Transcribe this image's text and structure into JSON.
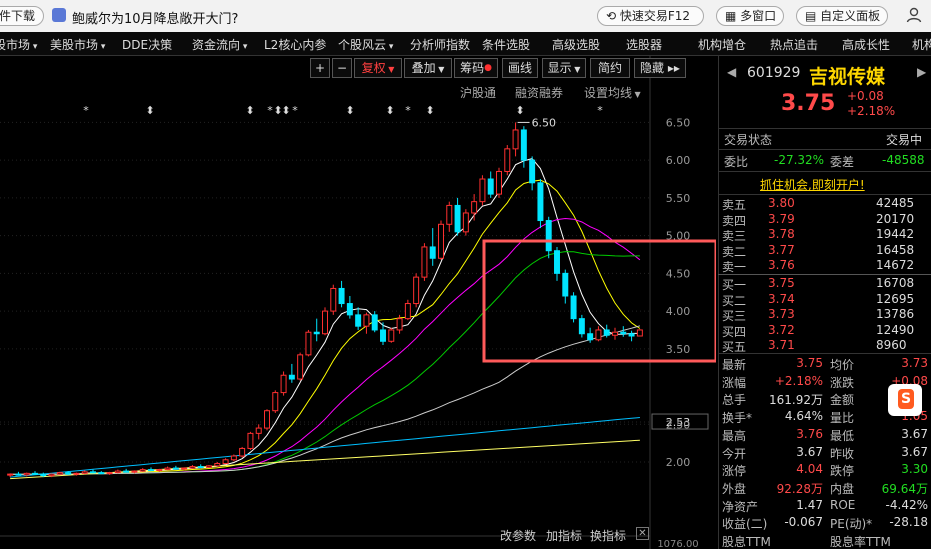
{
  "topbar": {
    "left_button": "软件下载",
    "news": "鲍威尔为10月降息敞开大门?",
    "quick_trade": "快速交易F12",
    "multi_window": "多窗口",
    "custom_panel": "自定义面板"
  },
  "menu": [
    "股市场",
    "美股市场",
    "DDE决策",
    "资金流向",
    "L2核心内参",
    "个股风云",
    "分析师指数",
    "条件选股",
    "高级选股",
    "选股器",
    "机构增仓",
    "热点追击",
    "高成长性",
    "机构"
  ],
  "chart_toolbar": {
    "plus": "+",
    "minus": "−",
    "fuquan": "复权",
    "diejia": "叠加",
    "chouma": "筹码",
    "huaxian": "画线",
    "xianshi": "显示",
    "jianyue": "简约",
    "yincang": "隐藏"
  },
  "subtabs": [
    "沪股通",
    "融资融券",
    "设置均线"
  ],
  "chart_bottom_tabs": [
    "改参数",
    "加指标",
    "换指标"
  ],
  "stock": {
    "code": "601929",
    "name": "吉视传媒",
    "price": "3.75",
    "change": "+0.08",
    "change_pct": "+2.18%"
  },
  "status": {
    "label": "交易状态",
    "value": "交易中"
  },
  "weibi": {
    "label": "委比",
    "value": "-27.32%",
    "label2": "委差",
    "value2": "-48588"
  },
  "promo": "抓住机会,即刻开户!",
  "asks": [
    {
      "label": "卖五",
      "price": "3.80",
      "vol": "42485"
    },
    {
      "label": "卖四",
      "price": "3.79",
      "vol": "20170"
    },
    {
      "label": "卖三",
      "price": "3.78",
      "vol": "19442"
    },
    {
      "label": "卖二",
      "price": "3.77",
      "vol": "16458"
    },
    {
      "label": "卖一",
      "price": "3.76",
      "vol": "14672"
    }
  ],
  "bids": [
    {
      "label": "买一",
      "price": "3.75",
      "vol": "16708"
    },
    {
      "label": "买二",
      "price": "3.74",
      "vol": "12695"
    },
    {
      "label": "买三",
      "price": "3.73",
      "vol": "13786"
    },
    {
      "label": "买四",
      "price": "3.72",
      "vol": "12490"
    },
    {
      "label": "买五",
      "price": "3.71",
      "vol": "8960"
    }
  ],
  "stats": [
    {
      "l1": "最新",
      "v1": "3.75",
      "c1": "red",
      "l2": "均价",
      "v2": "3.73",
      "c2": "red"
    },
    {
      "l1": "涨幅",
      "v1": "+2.18%",
      "c1": "red",
      "l2": "涨跌",
      "v2": "+0.08",
      "c2": "red"
    },
    {
      "l1": "总手",
      "v1": "161.92万",
      "c1": "white",
      "l2": "金额",
      "v2": "",
      "c2": "white"
    },
    {
      "l1": "换手*",
      "v1": "4.64%",
      "c1": "white",
      "l2": "量比",
      "v2": "1.05",
      "c2": "red"
    },
    {
      "l1": "最高",
      "v1": "3.76",
      "c1": "red",
      "l2": "最低",
      "v2": "3.67",
      "c2": "white"
    },
    {
      "l1": "今开",
      "v1": "3.67",
      "c1": "white",
      "l2": "昨收",
      "v2": "3.67",
      "c2": "white"
    },
    {
      "l1": "涨停",
      "v1": "4.04",
      "c1": "red",
      "l2": "跌停",
      "v2": "3.30",
      "c2": "green"
    },
    {
      "l1": "外盘",
      "v1": "92.28万",
      "c1": "red",
      "l2": "内盘",
      "v2": "69.64万",
      "c2": "green"
    },
    {
      "l1": "净资产",
      "v1": "1.47",
      "c1": "white",
      "l2": "ROE",
      "v2": "-4.42%",
      "c2": "white"
    },
    {
      "l1": "收益(二)",
      "v1": "-0.067",
      "c1": "white",
      "l2": "PE(动)*",
      "v2": "-28.18",
      "c2": "white"
    },
    {
      "l1": "股息TTM",
      "v1": "",
      "c1": "white",
      "l2": "股息率TTM",
      "v2": "",
      "c2": "white"
    }
  ],
  "chart_data": {
    "type": "candlestick",
    "y_ticks": [
      "6.50",
      "6.00",
      "5.50",
      "5.00",
      "4.50",
      "4.00",
      "3.50",
      "2.53",
      "2.50",
      "2.00"
    ],
    "max_label": "6.50",
    "current_label": "2.53",
    "volume_label": "1076.00",
    "ylim": [
      1.55,
      6.85
    ],
    "colors": {
      "up": "#ff3030",
      "down": "#00e5ff",
      "ma5": "#ffffff",
      "ma10": "#ffff00",
      "ma20": "#ff00ff",
      "ma30": "#00cc00",
      "ma60": "#cccccc",
      "ma120": "#00bfff",
      "ma250": "#ffff66",
      "highlight": "#ff5a5a"
    },
    "candles": [
      [
        1.83,
        1.85,
        1.8,
        1.84
      ],
      [
        1.84,
        1.87,
        1.82,
        1.83
      ],
      [
        1.83,
        1.86,
        1.81,
        1.85
      ],
      [
        1.85,
        1.88,
        1.83,
        1.84
      ],
      [
        1.84,
        1.86,
        1.8,
        1.82
      ],
      [
        1.82,
        1.85,
        1.8,
        1.84
      ],
      [
        1.84,
        1.87,
        1.83,
        1.86
      ],
      [
        1.86,
        1.88,
        1.83,
        1.84
      ],
      [
        1.84,
        1.86,
        1.82,
        1.85
      ],
      [
        1.85,
        1.89,
        1.84,
        1.87
      ],
      [
        1.87,
        1.9,
        1.85,
        1.86
      ],
      [
        1.86,
        1.88,
        1.84,
        1.85
      ],
      [
        1.85,
        1.87,
        1.83,
        1.86
      ],
      [
        1.86,
        1.9,
        1.85,
        1.88
      ],
      [
        1.88,
        1.91,
        1.86,
        1.87
      ],
      [
        1.87,
        1.89,
        1.85,
        1.88
      ],
      [
        1.88,
        1.92,
        1.87,
        1.9
      ],
      [
        1.9,
        1.93,
        1.88,
        1.89
      ],
      [
        1.89,
        1.91,
        1.87,
        1.9
      ],
      [
        1.9,
        1.94,
        1.89,
        1.92
      ],
      [
        1.92,
        1.95,
        1.9,
        1.91
      ],
      [
        1.91,
        1.93,
        1.89,
        1.92
      ],
      [
        1.92,
        1.96,
        1.91,
        1.94
      ],
      [
        1.94,
        1.97,
        1.92,
        1.93
      ],
      [
        1.93,
        1.96,
        1.92,
        1.95
      ],
      [
        1.95,
        2.0,
        1.94,
        1.98
      ],
      [
        1.98,
        2.05,
        1.97,
        2.03
      ],
      [
        2.03,
        2.1,
        2.01,
        2.08
      ],
      [
        2.08,
        2.2,
        2.06,
        2.18
      ],
      [
        2.18,
        2.4,
        2.16,
        2.38
      ],
      [
        2.38,
        2.5,
        2.3,
        2.45
      ],
      [
        2.45,
        2.7,
        2.42,
        2.68
      ],
      [
        2.68,
        2.95,
        2.65,
        2.92
      ],
      [
        2.92,
        3.2,
        2.88,
        3.15
      ],
      [
        3.15,
        3.3,
        3.05,
        3.1
      ],
      [
        3.1,
        3.45,
        3.08,
        3.42
      ],
      [
        3.42,
        3.75,
        3.4,
        3.72
      ],
      [
        3.72,
        3.9,
        3.6,
        3.7
      ],
      [
        3.7,
        4.05,
        3.68,
        4.0
      ],
      [
        4.0,
        4.35,
        3.95,
        4.3
      ],
      [
        4.3,
        4.4,
        4.05,
        4.1
      ],
      [
        4.1,
        4.2,
        3.9,
        3.95
      ],
      [
        3.95,
        4.05,
        3.75,
        3.8
      ],
      [
        3.8,
        3.98,
        3.7,
        3.95
      ],
      [
        3.95,
        4.0,
        3.72,
        3.75
      ],
      [
        3.75,
        3.85,
        3.55,
        3.6
      ],
      [
        3.6,
        3.78,
        3.58,
        3.75
      ],
      [
        3.75,
        3.95,
        3.7,
        3.9
      ],
      [
        3.9,
        4.15,
        3.88,
        4.1
      ],
      [
        4.1,
        4.5,
        4.05,
        4.45
      ],
      [
        4.45,
        4.9,
        4.4,
        4.85
      ],
      [
        4.85,
        5.1,
        4.6,
        4.7
      ],
      [
        4.7,
        5.2,
        4.68,
        5.15
      ],
      [
        5.15,
        5.45,
        5.05,
        5.4
      ],
      [
        5.4,
        5.5,
        5.0,
        5.05
      ],
      [
        5.05,
        5.35,
        5.0,
        5.3
      ],
      [
        5.3,
        5.55,
        5.2,
        5.45
      ],
      [
        5.45,
        5.8,
        5.4,
        5.75
      ],
      [
        5.75,
        5.85,
        5.5,
        5.55
      ],
      [
        5.55,
        5.9,
        5.5,
        5.85
      ],
      [
        5.85,
        6.2,
        5.8,
        6.15
      ],
      [
        6.15,
        6.5,
        6.05,
        6.4
      ],
      [
        6.4,
        6.45,
        5.9,
        6.0
      ],
      [
        6.0,
        6.05,
        5.6,
        5.7
      ],
      [
        5.7,
        5.75,
        5.1,
        5.2
      ],
      [
        5.2,
        5.25,
        4.7,
        4.8
      ],
      [
        4.8,
        4.85,
        4.4,
        4.5
      ],
      [
        4.5,
        4.55,
        4.1,
        4.2
      ],
      [
        4.2,
        4.25,
        3.85,
        3.9
      ],
      [
        3.9,
        3.95,
        3.65,
        3.7
      ],
      [
        3.7,
        3.78,
        3.58,
        3.62
      ],
      [
        3.62,
        3.8,
        3.6,
        3.75
      ],
      [
        3.75,
        3.82,
        3.65,
        3.68
      ],
      [
        3.68,
        3.78,
        3.62,
        3.72
      ],
      [
        3.72,
        3.8,
        3.66,
        3.7
      ],
      [
        3.7,
        3.74,
        3.6,
        3.67
      ],
      [
        3.67,
        3.76,
        3.67,
        3.75
      ]
    ]
  }
}
